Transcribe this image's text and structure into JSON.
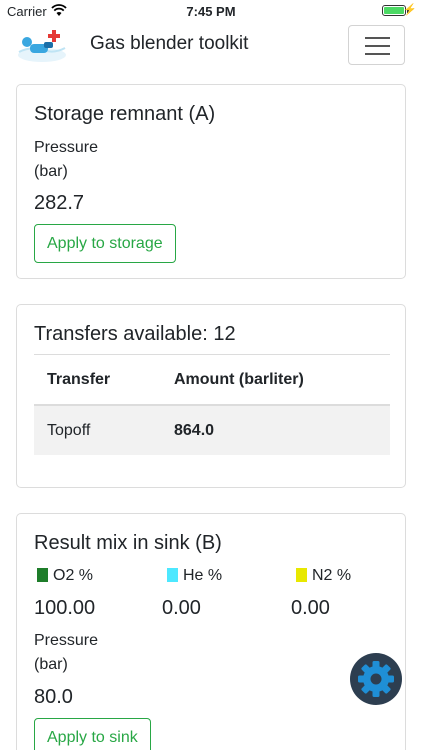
{
  "status_bar": {
    "carrier": "Carrier",
    "time": "7:45 PM"
  },
  "navbar": {
    "title": "Gas blender toolkit",
    "menu_icon": "hamburger-menu-icon",
    "logo_icon": "diver-logo-icon"
  },
  "storage": {
    "title": "Storage remnant (A)",
    "pressure_label": "Pressure",
    "pressure_unit": "(bar)",
    "pressure_value": "282.7",
    "apply_label": "Apply to storage"
  },
  "transfers": {
    "title": "Transfers available: 12",
    "columns": [
      "Transfer",
      "Amount (barliter)"
    ],
    "rows": [
      {
        "transfer": "Topoff",
        "amount": "864.0"
      }
    ]
  },
  "result": {
    "title": "Result mix in sink (B)",
    "gases": [
      {
        "label": "O2 %",
        "value": "100.00",
        "color": "#1e7d2a"
      },
      {
        "label": "He %",
        "value": "0.00",
        "color": "#4de8ff"
      },
      {
        "label": "N2 %",
        "value": "0.00",
        "color": "#e8e800"
      }
    ],
    "pressure_label": "Pressure",
    "pressure_unit": "(bar)",
    "pressure_value": "80.0",
    "apply_label": "Apply to sink"
  },
  "fab": {
    "icon": "gear-icon"
  },
  "colors": {
    "accent": "#28a745",
    "fab": "#2d3e50",
    "fab_icon": "#1f8fd6"
  }
}
